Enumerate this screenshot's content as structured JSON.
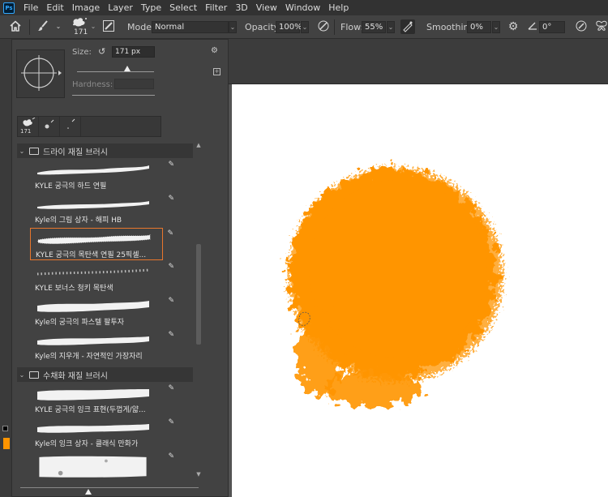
{
  "menubar": {
    "logo": "Ps",
    "items": [
      "File",
      "Edit",
      "Image",
      "Layer",
      "Type",
      "Select",
      "Filter",
      "3D",
      "View",
      "Window",
      "Help"
    ]
  },
  "options": {
    "brush_size": "171",
    "mode_label": "Mode:",
    "mode_value": "Normal",
    "opacity_label": "Opacity:",
    "opacity_value": "100%",
    "flow_label": "Flow:",
    "flow_value": "55%",
    "smoothing_label": "Smoothing:",
    "smoothing_value": "0%",
    "angle_value": "0°"
  },
  "brush_panel": {
    "size_label": "Size:",
    "size_value": "171 px",
    "hardness_label": "Hardness:",
    "recent_sizes": [
      "171",
      "",
      ""
    ],
    "groups": [
      {
        "name": "드라이 재질 브러시",
        "brushes": [
          {
            "name": "KYLE 궁극의 하드 연필",
            "selected": false
          },
          {
            "name": "Kyle의 그림 상자 - 해피 HB",
            "selected": false
          },
          {
            "name": "KYLE 궁극의 목탄색 연필 25픽셀...",
            "selected": true
          },
          {
            "name": "KYLE 보너스 청키 목탄색",
            "selected": false
          },
          {
            "name": "Kyle의 궁극의 파스텔 팔투자",
            "selected": false
          },
          {
            "name": "Kyle의 지우개 - 자연적인 가장자리",
            "selected": false
          }
        ]
      },
      {
        "name": "수채화 재질 브러시",
        "brushes": [
          {
            "name": "KYLE 궁극의 잉크 표현(두껍게/얇...",
            "selected": false
          },
          {
            "name": "Kyle의 잉크 상자 - 클래식 만화가",
            "selected": false
          }
        ]
      }
    ]
  },
  "colors": {
    "paint": "#ff9500",
    "selection_border": "#e8762c",
    "canvas": "#ffffff"
  }
}
